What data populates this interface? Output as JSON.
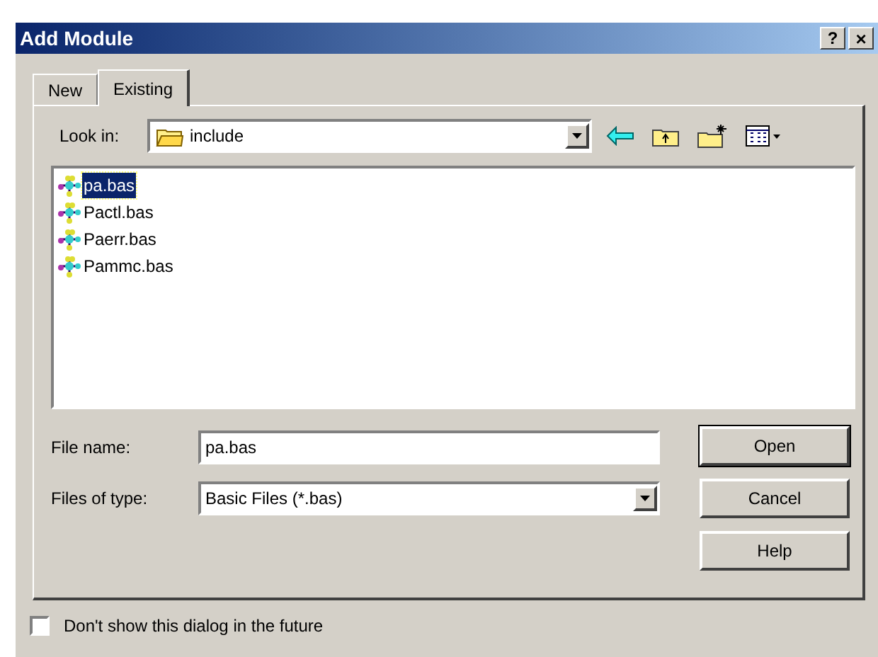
{
  "window": {
    "title": "Add Module",
    "help_button": "?",
    "close_button": "×"
  },
  "tabs": [
    {
      "label": "New",
      "selected": false
    },
    {
      "label": "Existing",
      "selected": true
    }
  ],
  "look_in": {
    "label": "Look in:",
    "value": "include"
  },
  "files": [
    {
      "name": "pa.bas",
      "selected": true
    },
    {
      "name": "Pactl.bas",
      "selected": false
    },
    {
      "name": "Paerr.bas",
      "selected": false
    },
    {
      "name": "Pammc.bas",
      "selected": false
    }
  ],
  "file_name": {
    "label": "File name:",
    "value": "pa.bas"
  },
  "file_type": {
    "label": "Files of type:",
    "value": "Basic Files (*.bas)"
  },
  "buttons": [
    {
      "label": "Open",
      "default": true
    },
    {
      "label": "Cancel",
      "default": false
    },
    {
      "label": "Help",
      "default": false
    }
  ],
  "dont_show": {
    "label": "Don't show this dialog in the future",
    "checked": false
  }
}
